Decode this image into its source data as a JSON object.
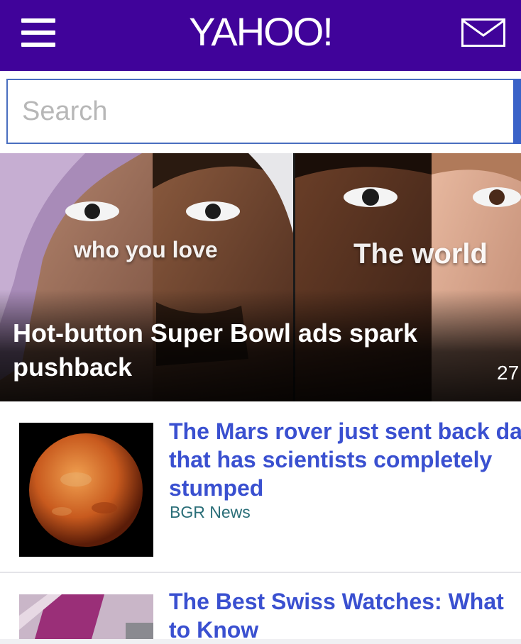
{
  "header": {
    "logo": "YAHOO!",
    "menu_icon": "hamburger-menu-icon",
    "mail_icon": "mail-envelope-icon",
    "background": "#40039a"
  },
  "search": {
    "placeholder": "Search",
    "value": ""
  },
  "hero": {
    "overlay_left": "who you love",
    "overlay_right": "The world",
    "headline": "Hot-button Super Bowl ads spark pushback",
    "count": "27"
  },
  "stories": [
    {
      "headline_lines": [
        "The Mars rover just sent back da",
        "that has scientists completely",
        "stumped"
      ],
      "source": "BGR News"
    },
    {
      "headline_lines": [
        "The Best Swiss Watches: What",
        "to Know"
      ]
    }
  ]
}
